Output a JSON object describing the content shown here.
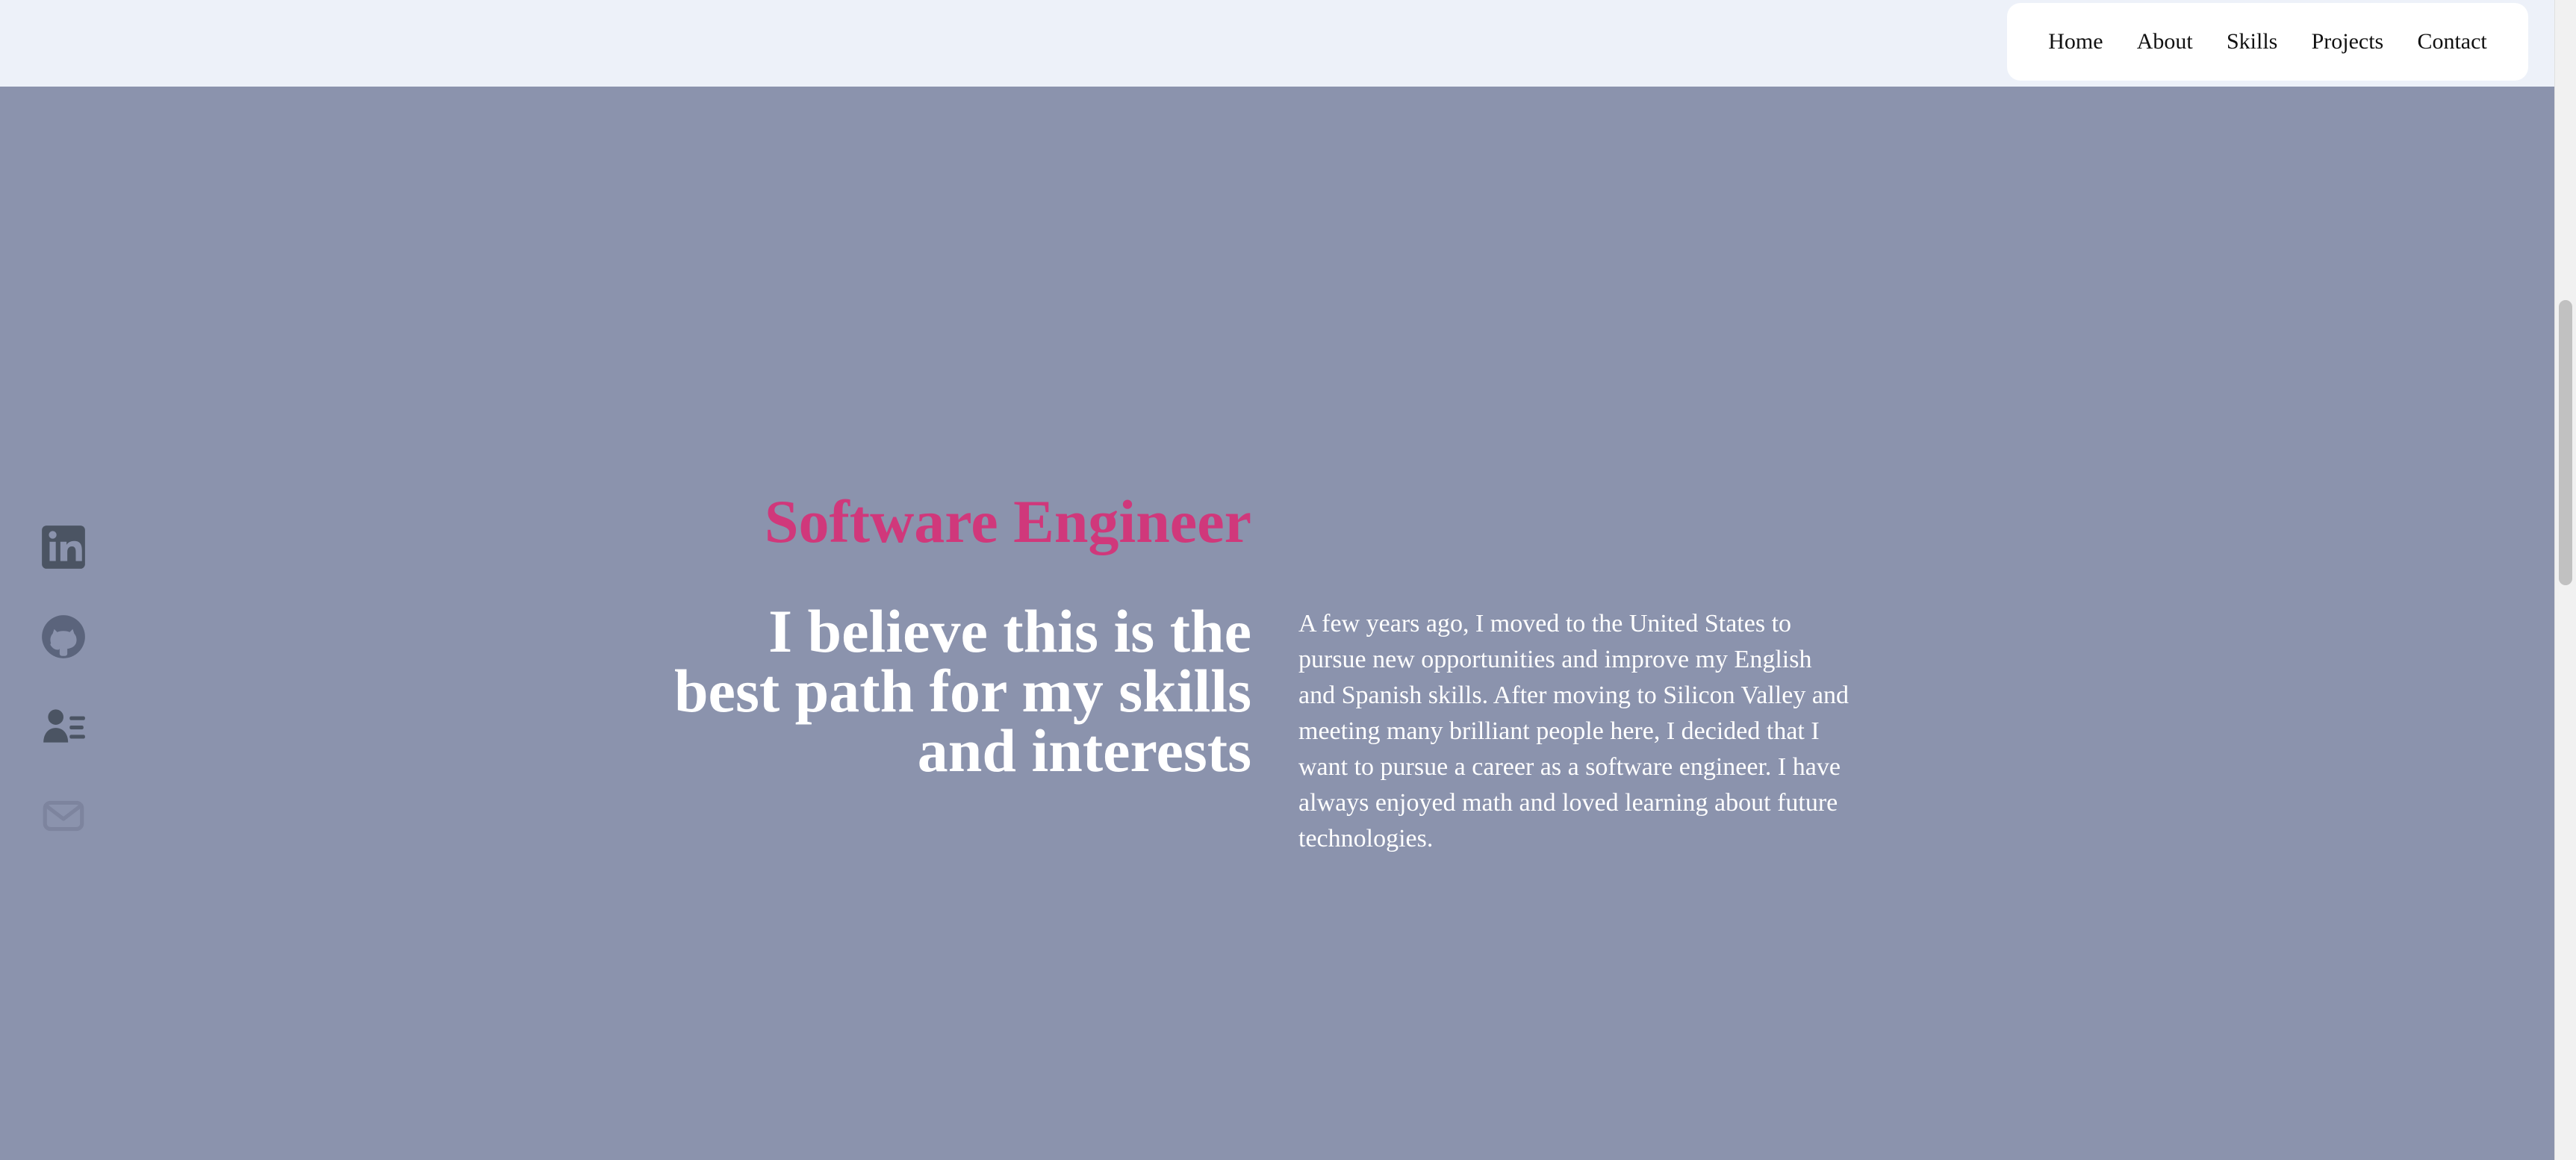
{
  "nav": {
    "items": [
      {
        "label": "Home"
      },
      {
        "label": "About"
      },
      {
        "label": "Skills"
      },
      {
        "label": "Projects"
      },
      {
        "label": "Contact"
      }
    ]
  },
  "social": {
    "icons": [
      "linkedin-icon",
      "github-icon",
      "resume-icon",
      "mail-icon"
    ]
  },
  "hero": {
    "role": "Software Engineer",
    "headline": "I believe this is the best path for my skills and interests",
    "bio": "A few years ago, I moved to the United States to pursue new opportunities and improve my English and Spanish skills. After moving to Silicon Valley and meeting many brilliant people here, I decided that I want to pursue a career as a software engineer. I have always enjoyed math and loved learning about future technologies."
  },
  "colors": {
    "background": "#8b93ad",
    "header": "#edf1f9",
    "accent": "#d0387b",
    "icon": "#4b5463"
  }
}
